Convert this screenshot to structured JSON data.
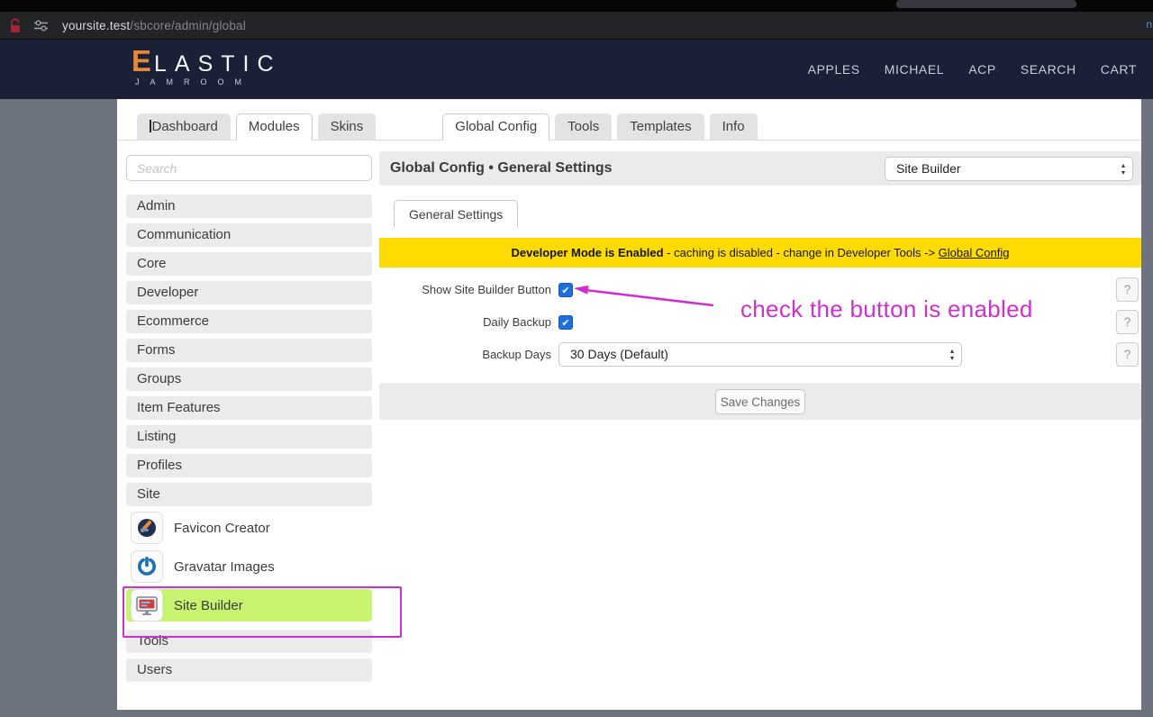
{
  "browser": {
    "url_host": "yoursite.test",
    "url_path": "/sbcore/admin/global",
    "right_hint": "n"
  },
  "header": {
    "logo_first": "E",
    "logo_rest": "LASTIC",
    "logo_sub": "JAMROOM",
    "nav": [
      {
        "label": "APPLES"
      },
      {
        "label": "MICHAEL"
      },
      {
        "label": "ACP"
      },
      {
        "label": "SEARCH"
      },
      {
        "label": "CART"
      }
    ]
  },
  "tabs": {
    "left": [
      {
        "label": "Dashboard",
        "active": false
      },
      {
        "label": "Modules",
        "active": true
      },
      {
        "label": "Skins",
        "active": false
      }
    ],
    "right": [
      {
        "label": "Global Config",
        "active": true
      },
      {
        "label": "Tools",
        "active": false
      },
      {
        "label": "Templates",
        "active": false
      },
      {
        "label": "Info",
        "active": false
      }
    ]
  },
  "sidebar": {
    "search_placeholder": "Search",
    "sections": [
      "Admin",
      "Communication",
      "Core",
      "Developer",
      "Ecommerce",
      "Forms",
      "Groups",
      "Item Features",
      "Listing",
      "Profiles",
      "Site"
    ],
    "modules": [
      {
        "label": "Favicon Creator",
        "icon": "favicon-creator-icon",
        "highlighted": false
      },
      {
        "label": "Gravatar Images",
        "icon": "gravatar-icon",
        "highlighted": false
      },
      {
        "label": "Site Builder",
        "icon": "site-builder-icon",
        "highlighted": true
      }
    ],
    "after": [
      "Tools",
      "Users"
    ]
  },
  "main": {
    "title": "Global Config • General Settings",
    "module_select_value": "Site Builder",
    "active_tab": "General Settings",
    "banner": {
      "bold": "Developer Mode is Enabled",
      "middle": " - caching is disabled - change in Developer Tools -> ",
      "link": "Global Config"
    },
    "fields": [
      {
        "label": "Show Site Builder Button",
        "type": "checkbox",
        "checked": true
      },
      {
        "label": "Daily Backup",
        "type": "checkbox",
        "checked": true
      },
      {
        "label": "Backup Days",
        "type": "select",
        "value": "30 Days (Default)"
      }
    ],
    "help_label": "?",
    "save_button": "Save Changes"
  },
  "annotations": {
    "note_text": "check the button is enabled",
    "accent_color": "#d02fd0"
  },
  "colors": {
    "header_navy": "#1a2036",
    "banner_yellow": "#ffdb00",
    "highlight_green": "#c7f36e",
    "checkbox_blue": "#1e6ee0",
    "annotation_magenta": "#d02fd0",
    "logo_orange": "#e8873a"
  }
}
